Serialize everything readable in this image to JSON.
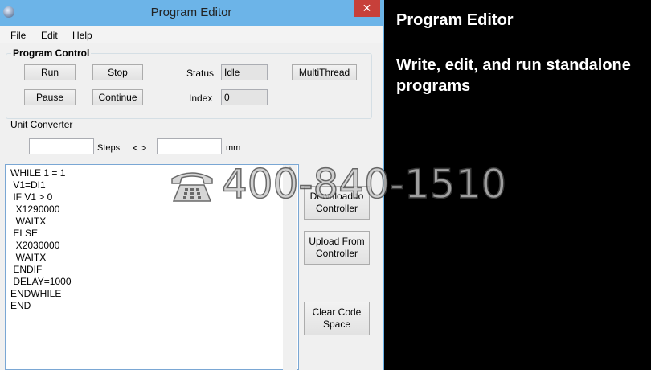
{
  "window": {
    "title": "Program Editor",
    "close": "✕"
  },
  "menu": [
    "File",
    "Edit",
    "Help"
  ],
  "program_control": {
    "label": "Program Control",
    "run": "Run",
    "stop": "Stop",
    "pause": "Pause",
    "continue": "Continue",
    "multithread": "MultiThread",
    "status_label": "Status",
    "status_value": "Idle",
    "index_label": "Index",
    "index_value": "0"
  },
  "unit_converter": {
    "label": "Unit Converter",
    "steps": "Steps",
    "arrows": "< >",
    "mm": "mm"
  },
  "code_lines": [
    "WHILE 1 = 1",
    " V1=DI1",
    " IF V1 > 0",
    "  X1290000",
    "  WAITX",
    " ELSE",
    "  X2030000",
    "  WAITX",
    " ENDIF",
    " DELAY=1000",
    "ENDWHILE",
    "END"
  ],
  "side_buttons": {
    "download": "Download to Controller",
    "upload": "Upload From Controller",
    "clear": "Clear Code Space"
  },
  "info_panel": {
    "title": "Program Editor",
    "description": "Write, edit, and run standalone programs"
  },
  "watermark": {
    "text": "400-840-1510",
    "icon": "telephone-icon"
  }
}
